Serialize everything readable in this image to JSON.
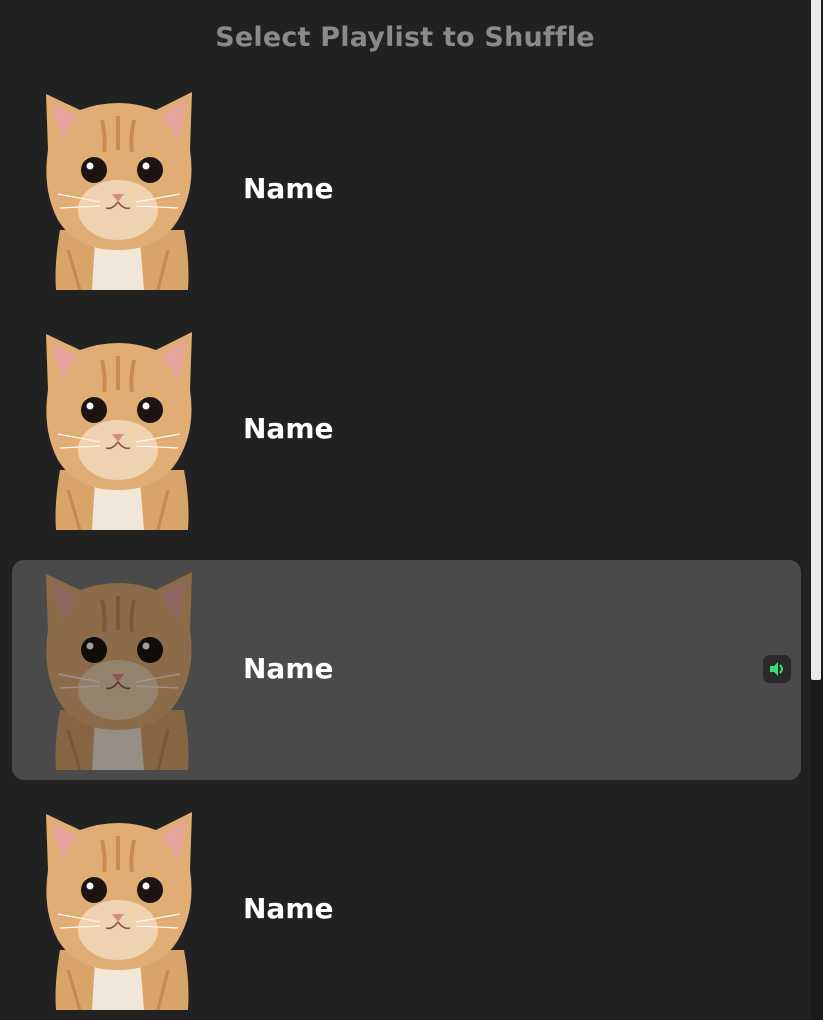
{
  "header": {
    "title": "Select Playlist to Shuffle"
  },
  "playlists": [
    {
      "name": "Name",
      "thumbnail": "kitten-photo",
      "selected": false,
      "playing": false
    },
    {
      "name": "Name",
      "thumbnail": "kitten-photo",
      "selected": false,
      "playing": false
    },
    {
      "name": "Name",
      "thumbnail": "kitten-photo",
      "selected": true,
      "playing": true,
      "indicator_icon": "speaker-icon"
    },
    {
      "name": "Name",
      "thumbnail": "kitten-photo",
      "selected": false,
      "playing": false
    }
  ],
  "colors": {
    "background": "#212121",
    "selected_row": "#4a4a4a",
    "title": "#8a8a8a",
    "accent": "#3ddc74"
  }
}
